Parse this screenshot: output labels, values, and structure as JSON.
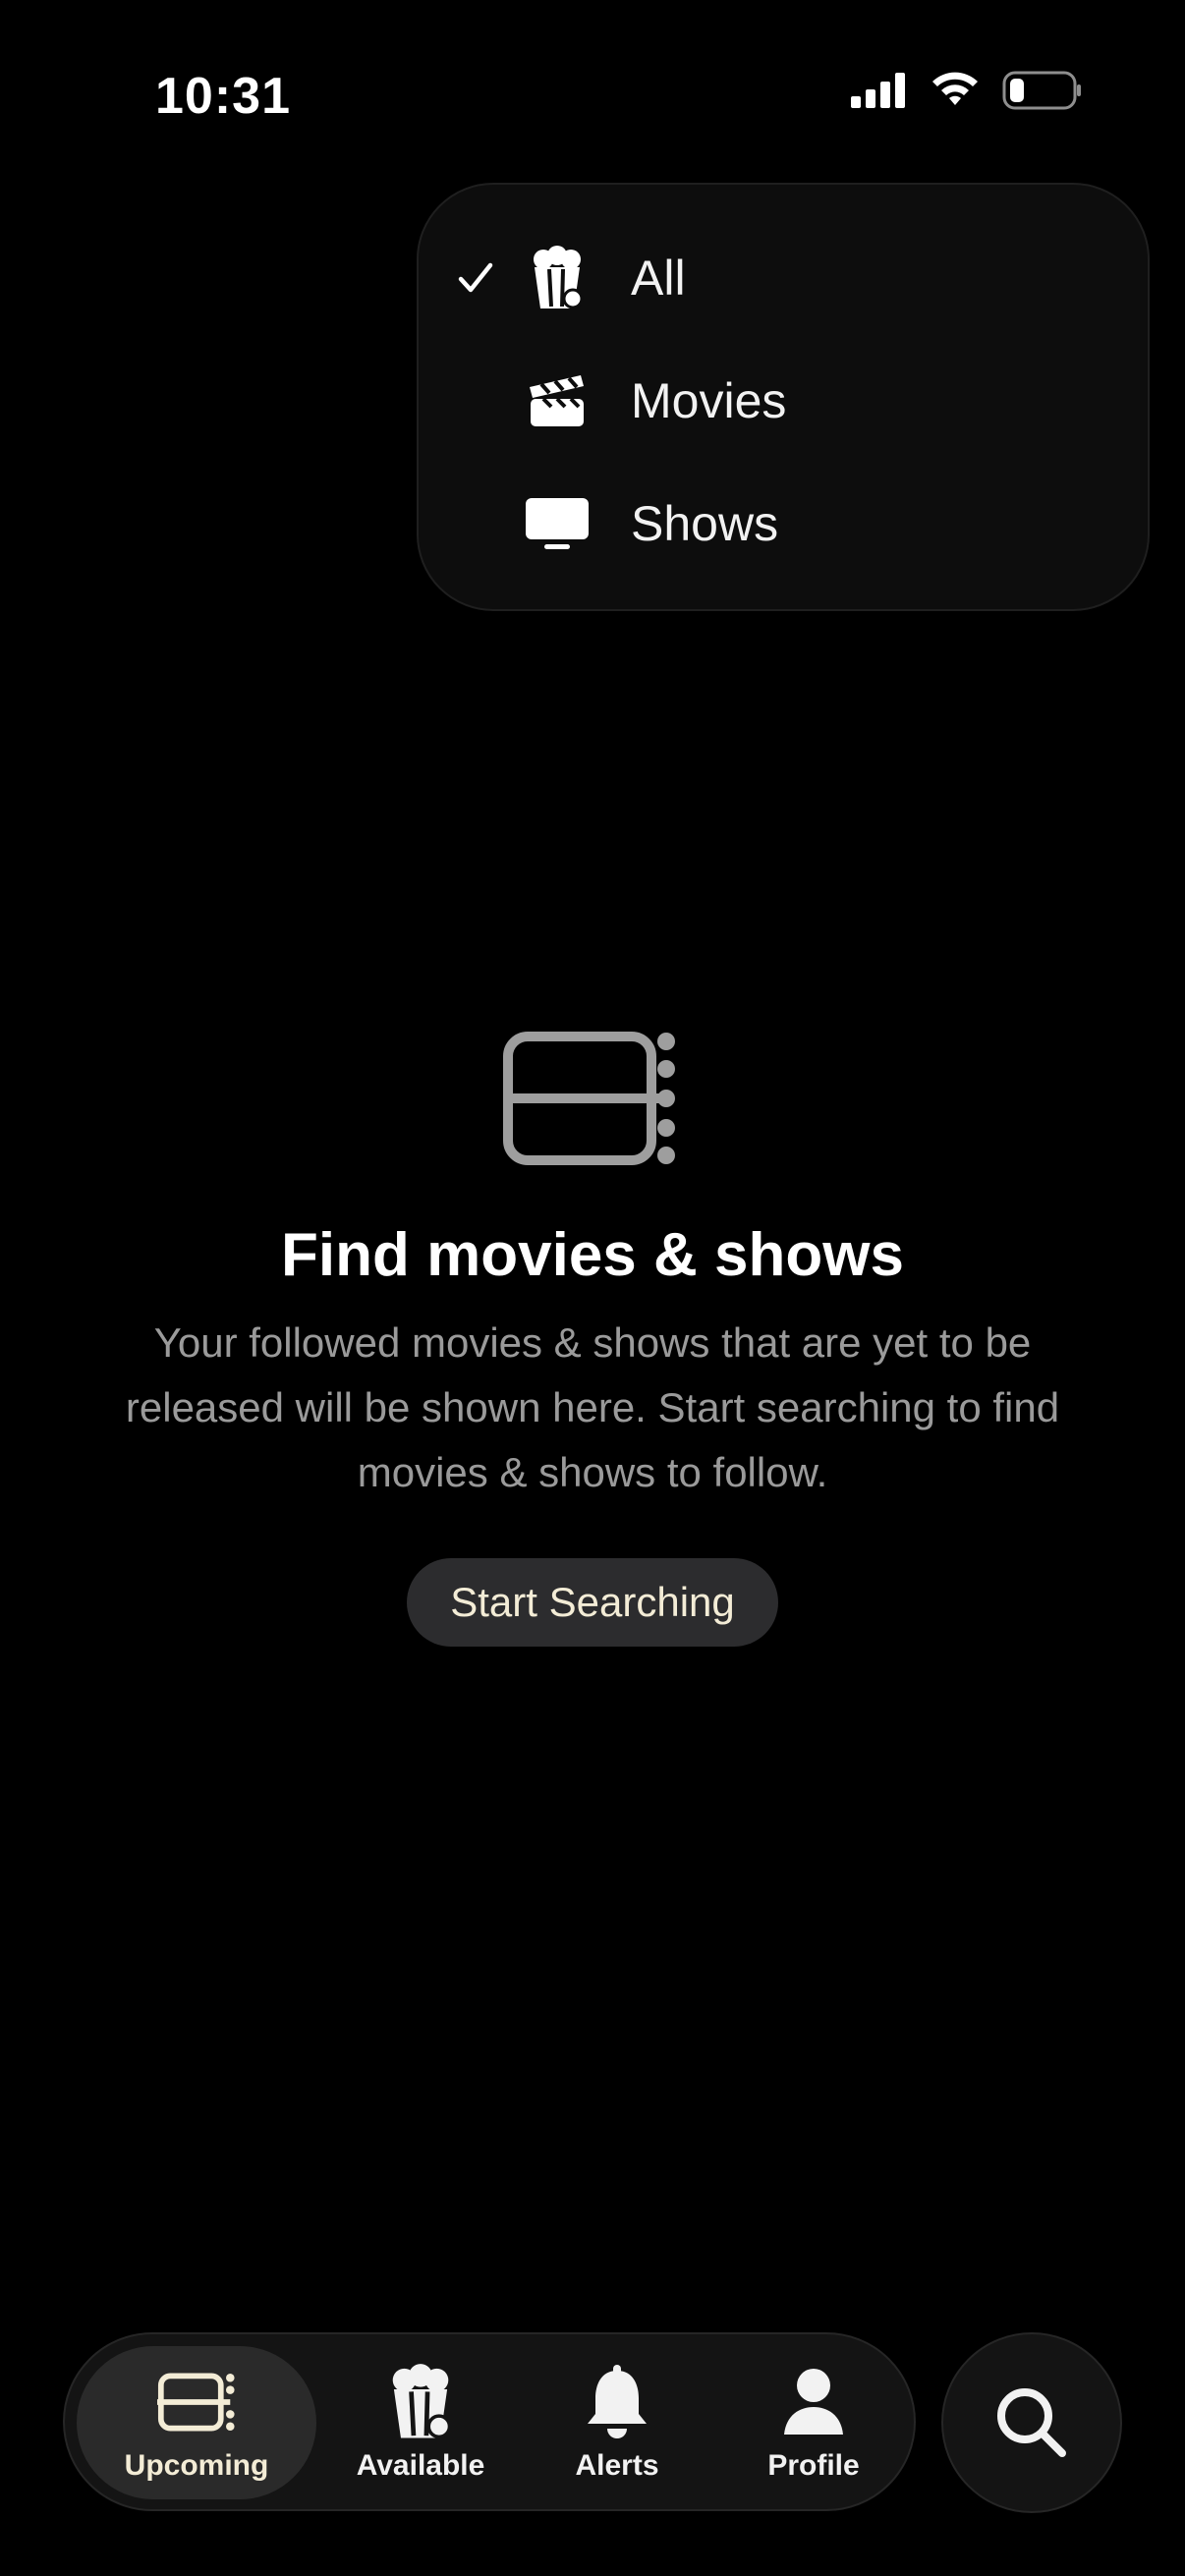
{
  "status_bar": {
    "time": "10:31",
    "battery_level": 0.2
  },
  "filter_menu": {
    "selected": "All",
    "items": [
      {
        "label": "All",
        "icon": "popcorn-icon",
        "checked": true
      },
      {
        "label": "Movies",
        "icon": "clapperboard-icon",
        "checked": false
      },
      {
        "label": "Shows",
        "icon": "tv-icon",
        "checked": false
      }
    ]
  },
  "empty_state": {
    "icon": "film-strip-icon",
    "title": "Find movies & shows",
    "description": "Your followed movies & shows that are yet to be released will be shown here. Start searching to find movies & shows to follow.",
    "button_label": "Start Searching"
  },
  "tab_bar": {
    "active": "Upcoming",
    "tabs": [
      {
        "label": "Upcoming",
        "icon": "film-strip-icon"
      },
      {
        "label": "Available",
        "icon": "popcorn-icon"
      },
      {
        "label": "Alerts",
        "icon": "bell-icon"
      },
      {
        "label": "Profile",
        "icon": "person-icon"
      }
    ],
    "search_icon": "search-icon"
  },
  "colors": {
    "background": "#000000",
    "accent_cream": "#f3ecd6",
    "secondary_text": "#9a9a9a",
    "surface": "#141414"
  }
}
